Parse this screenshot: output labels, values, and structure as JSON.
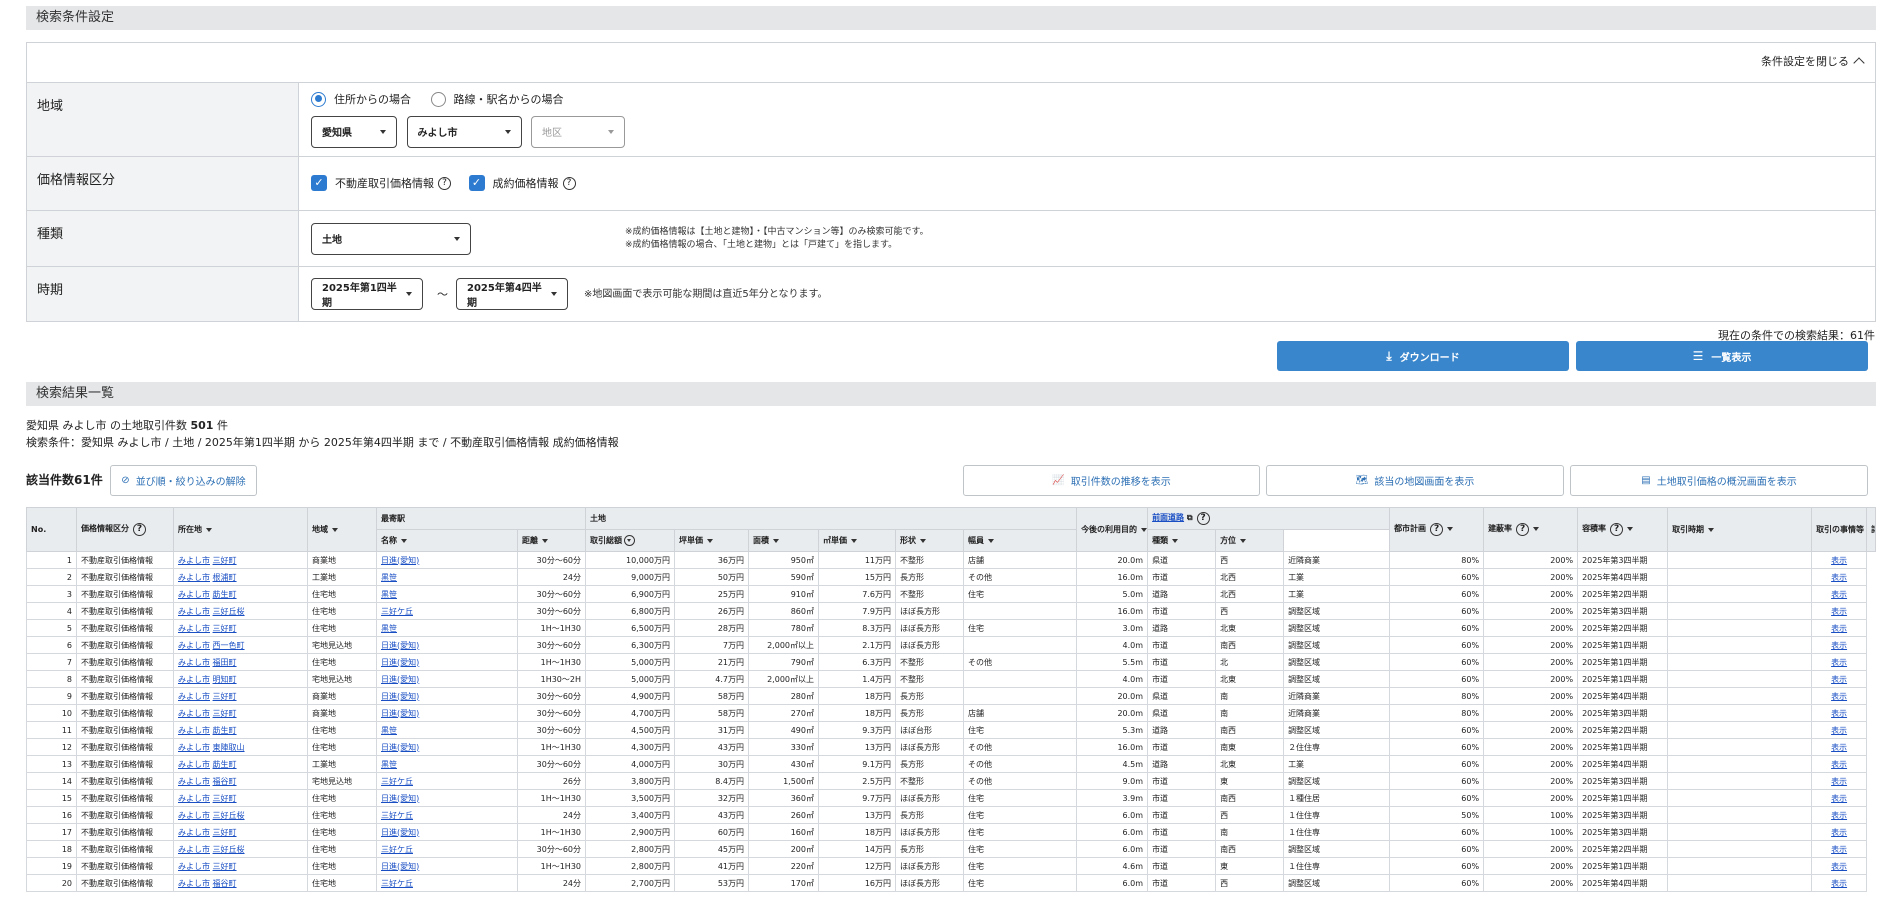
{
  "conditions": {
    "title": "検索条件設定",
    "close_label": "条件設定を閉じる",
    "region": {
      "label": "地域",
      "radio_address": "住所からの場合",
      "radio_station": "路線・駅名からの場合",
      "prefecture": "愛知県",
      "city": "みよし市",
      "district_placeholder": "地区"
    },
    "price_type": {
      "label": "価格情報区分",
      "opt1": "不動産取引価格情報",
      "opt2": "成約価格情報"
    },
    "kind": {
      "label": "種類",
      "value": "土地",
      "note1": "※成約価格情報は【土地と建物】・【中古マンション等】のみ検索可能です。",
      "note2": "※成約価格情報の場合、「土地と建物」とは「戸建て」を指します。"
    },
    "period": {
      "label": "時期",
      "from": "2025年第1四半期",
      "tilde": "～",
      "to": "2025年第4四半期",
      "note": "※地図画面で表示可能な期間は直近5年分となります。"
    }
  },
  "result_count_text": "現在の条件での検索結果：61件",
  "buttons": {
    "download": "ダウンロード",
    "list": "一覧表示"
  },
  "results": {
    "title": "検索結果一覧",
    "summary_prefix": "愛知県 みよし市 の土地取引件数 ",
    "summary_count": "501",
    "summary_suffix": " 件",
    "criteria": "検索条件：愛知県 みよし市 / 土地 / 2025年第1四半期 から 2025年第4四半期 まで / 不動産取引価格情報 成約価格情報",
    "hits": "該当件数61件",
    "reset_filter": "並び順・絞り込みの解除",
    "trend": "取引件数の推移を表示",
    "map": "該当の地図画面を表示",
    "overview": "土地取引価格の概況画面を表示"
  },
  "table": {
    "h_no": "No.",
    "h_kubun": "価格情報区分",
    "h_loc": "所在地",
    "h_area": "地域",
    "h_station": "最寄駅",
    "h_name": "名称",
    "h_dist": "距離",
    "h_land": "土地",
    "h_total": "取引総額",
    "h_tsubo": "坪単価",
    "h_menseki": "面積",
    "h_m2": "㎡単価",
    "h_shape": "形状",
    "h_use": "今後の利用目的",
    "h_road": "前面道路",
    "h_width": "幅員",
    "h_type": "種類",
    "h_dir": "方位",
    "h_city": "都市計画",
    "h_bcr": "建蔽率",
    "h_far": "容積率",
    "h_time": "取引時期",
    "h_circ": "取引の事情等",
    "h_detail": "詳細表示",
    "rows": [
      [
        "1",
        "不動産取引価格情報",
        "みよし市",
        "三好町",
        "商業地",
        "日進(愛知)",
        "30分～60分",
        "10,000万円",
        "36万円",
        "950㎡",
        "11万円",
        "不整形",
        "店舗",
        "20.0m",
        "県道",
        "西",
        "近隣商業",
        "80%",
        "200%",
        "2025年第3四半期",
        "",
        "表示"
      ],
      [
        "2",
        "不動産取引価格情報",
        "みよし市",
        "根浦町",
        "工業地",
        "黒笹",
        "24分",
        "9,000万円",
        "50万円",
        "590㎡",
        "15万円",
        "長方形",
        "その他",
        "16.0m",
        "市道",
        "北西",
        "工業",
        "60%",
        "200%",
        "2025年第4四半期",
        "",
        "表示"
      ],
      [
        "3",
        "不動産取引価格情報",
        "みよし市",
        "莇生町",
        "住宅地",
        "黒笹",
        "30分～60分",
        "6,900万円",
        "25万円",
        "910㎡",
        "7.6万円",
        "不整形",
        "住宅",
        "5.0m",
        "道路",
        "北西",
        "工業",
        "60%",
        "200%",
        "2025年第2四半期",
        "",
        "表示"
      ],
      [
        "4",
        "不動産取引価格情報",
        "みよし市",
        "三好丘桜",
        "住宅地",
        "三好ケ丘",
        "30分～60分",
        "6,800万円",
        "26万円",
        "860㎡",
        "7.9万円",
        "ほぼ長方形",
        "",
        "16.0m",
        "市道",
        "西",
        "調整区域",
        "60%",
        "200%",
        "2025年第3四半期",
        "",
        "表示"
      ],
      [
        "5",
        "不動産取引価格情報",
        "みよし市",
        "三好町",
        "住宅地",
        "黒笹",
        "1H～1H30",
        "6,500万円",
        "28万円",
        "780㎡",
        "8.3万円",
        "ほぼ長方形",
        "住宅",
        "3.0m",
        "道路",
        "北東",
        "調整区域",
        "60%",
        "200%",
        "2025年第2四半期",
        "",
        "表示"
      ],
      [
        "6",
        "不動産取引価格情報",
        "みよし市",
        "西一色町",
        "宅地見込地",
        "日進(愛知)",
        "30分～60分",
        "6,300万円",
        "7万円",
        "2,000㎡以上",
        "2.1万円",
        "ほぼ長方形",
        "",
        "4.0m",
        "市道",
        "南西",
        "調整区域",
        "60%",
        "200%",
        "2025年第1四半期",
        "",
        "表示"
      ],
      [
        "7",
        "不動産取引価格情報",
        "みよし市",
        "福田町",
        "住宅地",
        "日進(愛知)",
        "1H～1H30",
        "5,000万円",
        "21万円",
        "790㎡",
        "6.3万円",
        "不整形",
        "その他",
        "5.5m",
        "市道",
        "北",
        "調整区域",
        "60%",
        "200%",
        "2025年第1四半期",
        "",
        "表示"
      ],
      [
        "8",
        "不動産取引価格情報",
        "みよし市",
        "明知町",
        "宅地見込地",
        "日進(愛知)",
        "1H30～2H",
        "5,000万円",
        "4.7万円",
        "2,000㎡以上",
        "1.4万円",
        "不整形",
        "",
        "4.0m",
        "市道",
        "北東",
        "調整区域",
        "60%",
        "200%",
        "2025年第1四半期",
        "",
        "表示"
      ],
      [
        "9",
        "不動産取引価格情報",
        "みよし市",
        "三好町",
        "商業地",
        "日進(愛知)",
        "30分～60分",
        "4,900万円",
        "58万円",
        "280㎡",
        "18万円",
        "長方形",
        "",
        "20.0m",
        "県道",
        "南",
        "近隣商業",
        "80%",
        "200%",
        "2025年第4四半期",
        "",
        "表示"
      ],
      [
        "10",
        "不動産取引価格情報",
        "みよし市",
        "三好町",
        "商業地",
        "日進(愛知)",
        "30分～60分",
        "4,700万円",
        "58万円",
        "270㎡",
        "18万円",
        "長方形",
        "店舗",
        "20.0m",
        "県道",
        "南",
        "近隣商業",
        "80%",
        "200%",
        "2025年第3四半期",
        "",
        "表示"
      ],
      [
        "11",
        "不動産取引価格情報",
        "みよし市",
        "莇生町",
        "住宅地",
        "黒笹",
        "30分～60分",
        "4,500万円",
        "31万円",
        "490㎡",
        "9.3万円",
        "ほぼ台形",
        "住宅",
        "5.3m",
        "道路",
        "南西",
        "調整区域",
        "60%",
        "200%",
        "2025年第2四半期",
        "",
        "表示"
      ],
      [
        "12",
        "不動産取引価格情報",
        "みよし市",
        "東陣取山",
        "住宅地",
        "日進(愛知)",
        "1H～1H30",
        "4,300万円",
        "43万円",
        "330㎡",
        "13万円",
        "ほぼ長方形",
        "その他",
        "16.0m",
        "市道",
        "南東",
        "２住住専",
        "60%",
        "200%",
        "2025年第1四半期",
        "",
        "表示"
      ],
      [
        "13",
        "不動産取引価格情報",
        "みよし市",
        "莇生町",
        "工業地",
        "黒笹",
        "30分～60分",
        "4,000万円",
        "30万円",
        "430㎡",
        "9.1万円",
        "長方形",
        "その他",
        "4.5m",
        "道路",
        "北東",
        "工業",
        "60%",
        "200%",
        "2025年第4四半期",
        "",
        "表示"
      ],
      [
        "14",
        "不動産取引価格情報",
        "みよし市",
        "福谷町",
        "宅地見込地",
        "三好ケ丘",
        "26分",
        "3,800万円",
        "8.4万円",
        "1,500㎡",
        "2.5万円",
        "不整形",
        "その他",
        "9.0m",
        "市道",
        "東",
        "調整区域",
        "60%",
        "200%",
        "2025年第3四半期",
        "",
        "表示"
      ],
      [
        "15",
        "不動産取引価格情報",
        "みよし市",
        "三好町",
        "住宅地",
        "日進(愛知)",
        "1H～1H30",
        "3,500万円",
        "32万円",
        "360㎡",
        "9.7万円",
        "ほぼ長方形",
        "住宅",
        "3.9m",
        "市道",
        "南西",
        "１種住居",
        "60%",
        "200%",
        "2025年第1四半期",
        "",
        "表示"
      ],
      [
        "16",
        "不動産取引価格情報",
        "みよし市",
        "三好丘桜",
        "住宅地",
        "三好ケ丘",
        "24分",
        "3,400万円",
        "43万円",
        "260㎡",
        "13万円",
        "長方形",
        "住宅",
        "6.0m",
        "市道",
        "西",
        "１住住専",
        "50%",
        "100%",
        "2025年第3四半期",
        "",
        "表示"
      ],
      [
        "17",
        "不動産取引価格情報",
        "みよし市",
        "三好町",
        "住宅地",
        "日進(愛知)",
        "1H～1H30",
        "2,900万円",
        "60万円",
        "160㎡",
        "18万円",
        "ほぼ長方形",
        "住宅",
        "6.0m",
        "市道",
        "南",
        "１住住専",
        "60%",
        "100%",
        "2025年第3四半期",
        "",
        "表示"
      ],
      [
        "18",
        "不動産取引価格情報",
        "みよし市",
        "三好丘桜",
        "住宅地",
        "三好ケ丘",
        "30分～60分",
        "2,800万円",
        "45万円",
        "200㎡",
        "14万円",
        "長方形",
        "住宅",
        "6.0m",
        "市道",
        "南西",
        "調整区域",
        "60%",
        "200%",
        "2025年第2四半期",
        "",
        "表示"
      ],
      [
        "19",
        "不動産取引価格情報",
        "みよし市",
        "三好町",
        "住宅地",
        "日進(愛知)",
        "1H～1H30",
        "2,800万円",
        "41万円",
        "220㎡",
        "12万円",
        "ほぼ長方形",
        "住宅",
        "4.6m",
        "市道",
        "東",
        "１住住専",
        "60%",
        "200%",
        "2025年第1四半期",
        "",
        "表示"
      ],
      [
        "20",
        "不動産取引価格情報",
        "みよし市",
        "福谷町",
        "住宅地",
        "三好ケ丘",
        "24分",
        "2,700万円",
        "53万円",
        "170㎡",
        "16万円",
        "ほぼ長方形",
        "住宅",
        "6.0m",
        "市道",
        "西",
        "調整区域",
        "60%",
        "200%",
        "2025年第4四半期",
        "",
        "表示"
      ]
    ]
  },
  "colors": {
    "accent": "#3a86cc",
    "link": "#1a4fc4",
    "header_bg": "#e9ecef",
    "section_bg": "#e4e6e8"
  }
}
